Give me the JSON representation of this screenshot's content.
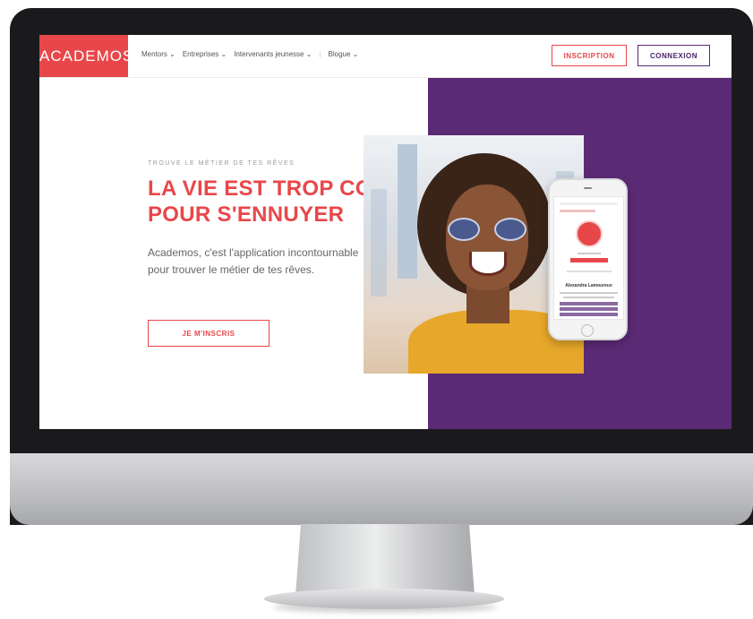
{
  "site": {
    "logo": "ACADEMOS",
    "nav": [
      "Mentors ⌄",
      "Entreprises ⌄",
      "Intervenants jeunesse ⌄",
      "Blogue ⌄"
    ],
    "buttons": {
      "inscription": "INSCRIPTION",
      "connexion": "CONNEXION"
    }
  },
  "hero": {
    "eyebrow": "TROUVE LE MÉTIER DE TES RÊVES",
    "headline_1": "LA VIE EST TROP COURTE",
    "headline_2": "POUR S'ENNUYER",
    "subtitle_1": "Academos, c'est l'application incontournable",
    "subtitle_2": "pour trouver le métier de tes rêves.",
    "cta": "JE M'INSCRIS"
  },
  "phone": {
    "profile_name": "Alexandra Lamoureux"
  },
  "colors": {
    "brand_red": "#e8474a",
    "brand_purple": "#5b2a75"
  }
}
